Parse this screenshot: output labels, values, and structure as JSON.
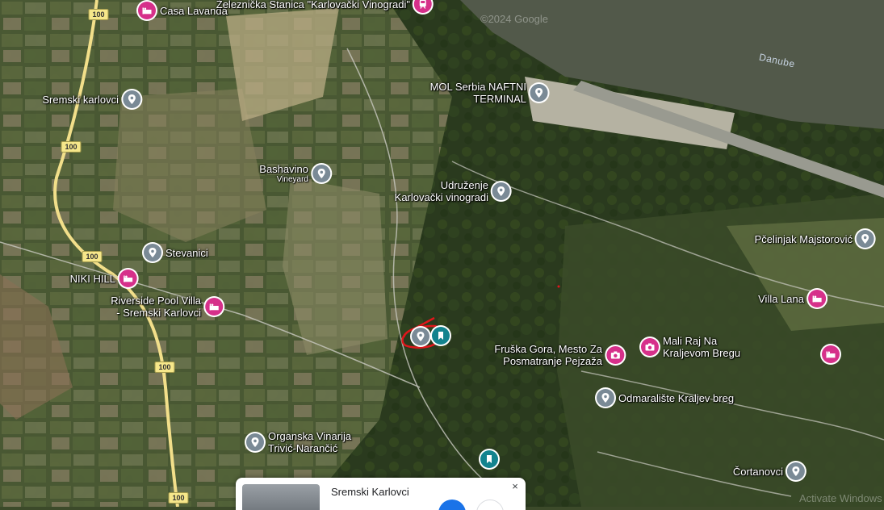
{
  "map": {
    "water_label": "Danube",
    "watermark": "©2024 Google",
    "activate_text": "Activate Windows",
    "route_badge": "100"
  },
  "places": [
    {
      "id": "casa-lavanda",
      "label": "Casa Lavanda",
      "icon": "hotel-icon",
      "color": "pink"
    },
    {
      "id": "zeleznicka",
      "label": "Železnička Stanica \"Karlovački Vinogradi\"",
      "icon": "train-icon",
      "color": "pink"
    },
    {
      "id": "sremski-karlovci",
      "label": "Sremski karlovci",
      "icon": "pin-icon",
      "color": "grey"
    },
    {
      "id": "mol-serbia",
      "label": "MOL Serbia NAFTNI",
      "label2": "TERMINAL",
      "icon": "pin-icon",
      "color": "grey"
    },
    {
      "id": "bashavino",
      "label": "Bashavino",
      "label2": "Vineyard",
      "icon": "pin-icon",
      "color": "grey"
    },
    {
      "id": "udruzenje",
      "label": "Udruženje",
      "label2": "Karlovački vinogradi",
      "icon": "pin-icon",
      "color": "grey"
    },
    {
      "id": "stevanici",
      "label": "Stevanici",
      "icon": "pin-icon",
      "color": "grey"
    },
    {
      "id": "niki-hill",
      "label": "NIKI HILL",
      "icon": "hotel-icon",
      "color": "pink"
    },
    {
      "id": "riverside",
      "label": "Riverside Pool Villa",
      "label2": "- Sremski Karlovci",
      "icon": "hotel-icon",
      "color": "pink"
    },
    {
      "id": "pcelinjak",
      "label": "Pčelinjak Majstorović",
      "icon": "pin-icon",
      "color": "grey"
    },
    {
      "id": "villa-lana",
      "label": "Villa Lana",
      "icon": "hotel-icon",
      "color": "pink"
    },
    {
      "id": "mali-raj",
      "label": "Mali Raj Na",
      "label2": "Kraljevom Bregu",
      "icon": "camera-icon",
      "color": "pink"
    },
    {
      "id": "fruska-gora",
      "label": "Fruška Gora, Mesto Za",
      "label2": "Posmatranje Pejzaža",
      "icon": "camera-icon",
      "color": "pink"
    },
    {
      "id": "hotel-east",
      "label": "",
      "icon": "hotel-icon",
      "color": "pink"
    },
    {
      "id": "odmaraliste",
      "label": "Odmaralište Kraljev breg",
      "icon": "pin-icon",
      "color": "grey"
    },
    {
      "id": "organska",
      "label": "Organska Vinarija",
      "label2": "Trivić-Narančić",
      "icon": "pin-icon",
      "color": "grey"
    },
    {
      "id": "cortanovci",
      "label": "Čortanovci",
      "icon": "pin-icon",
      "color": "grey"
    },
    {
      "id": "bookmark-south",
      "label": "",
      "icon": "bookmark-icon",
      "color": "teal"
    },
    {
      "id": "bookmark-center",
      "label": "",
      "icon": "bookmark-icon",
      "color": "teal"
    },
    {
      "id": "selected-pin",
      "label": "",
      "icon": "pin-icon",
      "color": "grey"
    }
  ],
  "info_card": {
    "title": "Sremski Karlovci",
    "close": "×"
  },
  "colors": {
    "pin_grey": "#7a8a96",
    "pin_pink": "#d6308a",
    "pin_teal": "#13838e",
    "annotation": "#e0161b",
    "water": "#52594a",
    "road_major": "#f2df8a"
  }
}
